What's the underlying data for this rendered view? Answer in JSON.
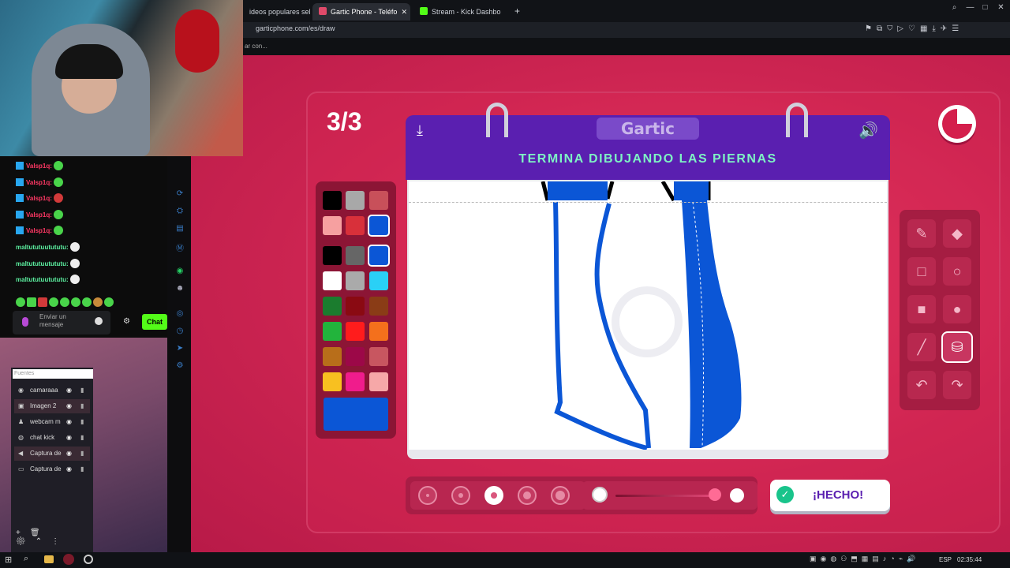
{
  "browser": {
    "tabs": [
      {
        "label": "ideos populares sel",
        "fav": ""
      },
      {
        "label": "Gartic Phone - Teléfo",
        "fav": "#e04a6a",
        "active": true
      },
      {
        "label": "Stream - Kick Dashbo",
        "fav": "#53fc18"
      }
    ],
    "close_glyph": "✕",
    "new_tab_glyph": "+",
    "url": "garticphone.com/es/draw",
    "bookmark_text": "ar con..."
  },
  "game": {
    "round": "3/3",
    "logo": "Gartic",
    "prompt": "TERMINA DIBUJANDO LAS PIERNAS",
    "done_label": "¡HECHO!",
    "palette": [
      [
        "#000000",
        "#a8a8a8",
        "#c8505a"
      ],
      [
        "#f6a0a0",
        "#d8303a",
        "#0b56d6"
      ],
      [
        "#000000",
        "#666666",
        "#0b56d6"
      ],
      [
        "#ffffff",
        "#aaaaaa",
        "#2ad0f6"
      ],
      [
        "#1b7c2e",
        "#8a0a12",
        "#8a3c16"
      ],
      [
        "#22b43c",
        "#ff1c1c",
        "#f4701c"
      ],
      [
        "#b86e1a",
        "#9c0848",
        "#c85660"
      ],
      [
        "#f8c020",
        "#f01c8c",
        "#f6a8a8"
      ]
    ],
    "current_color": "#0b56d6",
    "selected_swatch_row": 2,
    "brush_sizes": [
      1,
      2,
      3,
      4,
      5
    ],
    "selected_brush": 3,
    "opacity_level": 1.0,
    "tools": [
      {
        "name": "pencil-icon",
        "glyph": "✎"
      },
      {
        "name": "eraser-icon",
        "glyph": "◆"
      },
      {
        "name": "rectangle-outline-icon",
        "glyph": "□"
      },
      {
        "name": "circle-outline-icon",
        "glyph": "○"
      },
      {
        "name": "rectangle-filled-icon",
        "glyph": "■"
      },
      {
        "name": "circle-filled-icon",
        "glyph": "●"
      },
      {
        "name": "line-icon",
        "glyph": "╱"
      },
      {
        "name": "fill-bucket-icon",
        "glyph": "⛁",
        "selected": true
      },
      {
        "name": "undo-icon",
        "glyph": "↶"
      },
      {
        "name": "redo-icon",
        "glyph": "↷"
      }
    ]
  },
  "chat": {
    "messages": [
      {
        "user": "Valsp1q:",
        "color": "#ff3864",
        "badge": true,
        "emote": "#49d44a"
      },
      {
        "user": "Valsp1q:",
        "color": "#ff3864",
        "badge": true,
        "emote": "#49d44a"
      },
      {
        "user": "Valsp1q:",
        "color": "#ff3864",
        "badge": true,
        "emote": "#d23a3a"
      },
      {
        "user": "Valsp1q:",
        "color": "#ff3864",
        "badge": true,
        "emote": "#49d44a"
      },
      {
        "user": "Valsp1q:",
        "color": "#ff3864",
        "badge": true,
        "emote": "#49d44a"
      },
      {
        "user": "maltututuutututu:",
        "color": "#5cf0a0",
        "badge": false,
        "emote": "#eeeeee"
      },
      {
        "user": "maltututuutututu:",
        "color": "#5cf0a0",
        "badge": false,
        "emote": "#eeeeee"
      },
      {
        "user": "maltututuutututu:",
        "color": "#5cf0a0",
        "badge": false,
        "emote": "#eeeeee"
      }
    ],
    "input_placeholder": "Enviar un mensaje",
    "send_label": "Chat"
  },
  "obs": {
    "search_placeholder": "Fuentes",
    "sources": [
      {
        "label": "camaraaa",
        "icon": "◉",
        "hl": false
      },
      {
        "label": "Imagen 2",
        "icon": "▣",
        "hl": true
      },
      {
        "label": "webcam m",
        "icon": "♟",
        "hl": false
      },
      {
        "label": "chat kick",
        "icon": "◍",
        "hl": false
      },
      {
        "label": "Captura de",
        "icon": "◀",
        "hl": true
      },
      {
        "label": "Captura de",
        "icon": "▭",
        "hl": false
      }
    ]
  },
  "taskbar": {
    "lang": "ESP",
    "time": "02:35:44"
  }
}
